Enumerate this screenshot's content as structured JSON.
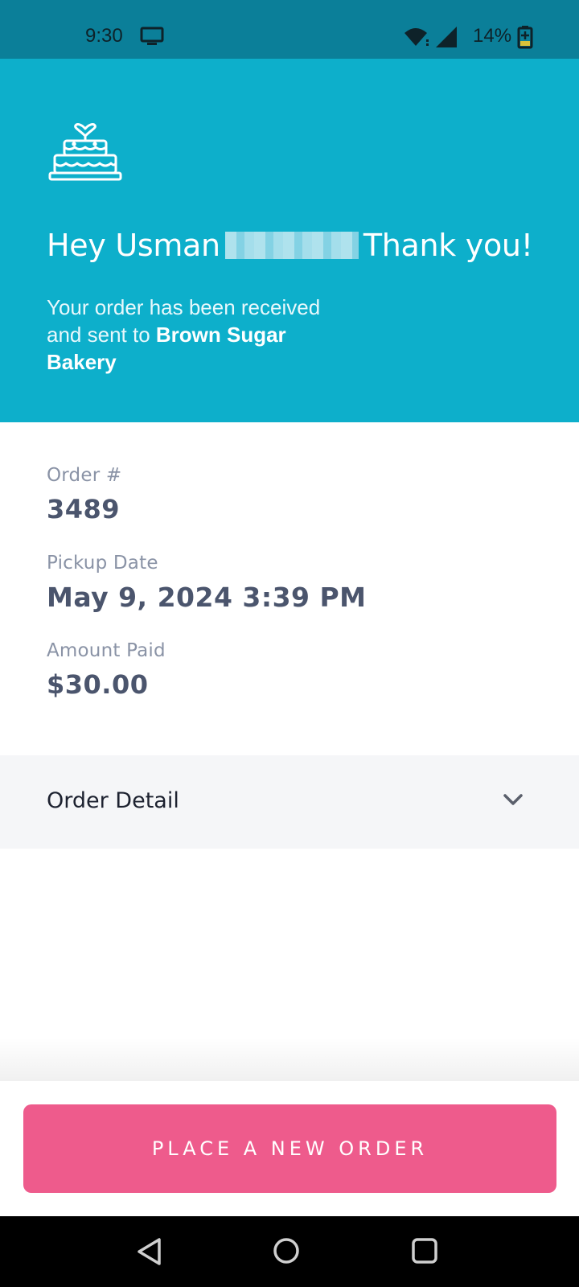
{
  "status_bar": {
    "time": "9:30",
    "battery": "14%",
    "icons": [
      "screen-cast-icon",
      "wifi-icon",
      "signal-icon",
      "battery-charging-icon"
    ]
  },
  "hero": {
    "icon": "cake-icon",
    "greeting_prefix": "Hey Usman",
    "greeting_suffix": "Thank you!",
    "message_prefix": "Your order has been received and sent to",
    "bakery_name": "Brown Sugar Bakery"
  },
  "order_info": {
    "order_label": "Order #",
    "order_number": "3489",
    "pickup_label": "Pickup Date",
    "pickup_date": "May 9, 2024 3:39 PM",
    "amount_label": "Amount Paid",
    "amount_paid": "$30.00"
  },
  "order_detail": {
    "label": "Order Detail",
    "icon": "chevron-down-icon"
  },
  "actions": {
    "place_new_order": "PLACE A NEW ORDER"
  },
  "nav_bar": {
    "icons": [
      "back-icon",
      "home-icon",
      "recents-icon"
    ]
  },
  "colors": {
    "status_bar": "#0b7f99",
    "hero_background": "#0dafcb",
    "primary_button": "#ee5b8c",
    "value_text": "#4b556d",
    "label_text": "#8a93a6",
    "accordion_background": "#f5f6f8"
  }
}
